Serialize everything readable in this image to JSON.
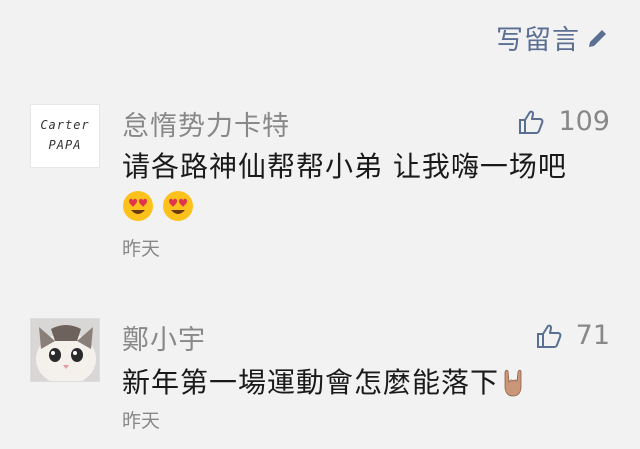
{
  "header": {
    "write_comment_label": "写留言"
  },
  "comments": [
    {
      "avatar_text": [
        "Carter",
        "PAPA"
      ],
      "name": "怠惰势力卡特",
      "likes": "109",
      "text": "请各路神仙帮帮小弟 让我嗨一场吧",
      "emojis": [
        "heart-eyes-emoji",
        "heart-eyes-emoji"
      ],
      "time": "昨天"
    },
    {
      "avatar": "cat-photo",
      "name": "鄭小宇",
      "likes": "71",
      "text": "新年第一場運動會怎麼能落下",
      "emojis": [
        "rock-on-hand-emoji"
      ],
      "time": "昨天"
    }
  ],
  "colors": {
    "link": "#5a6f92",
    "meta": "#888888",
    "text": "#1a1a1a",
    "background": "#f2f2f2"
  }
}
